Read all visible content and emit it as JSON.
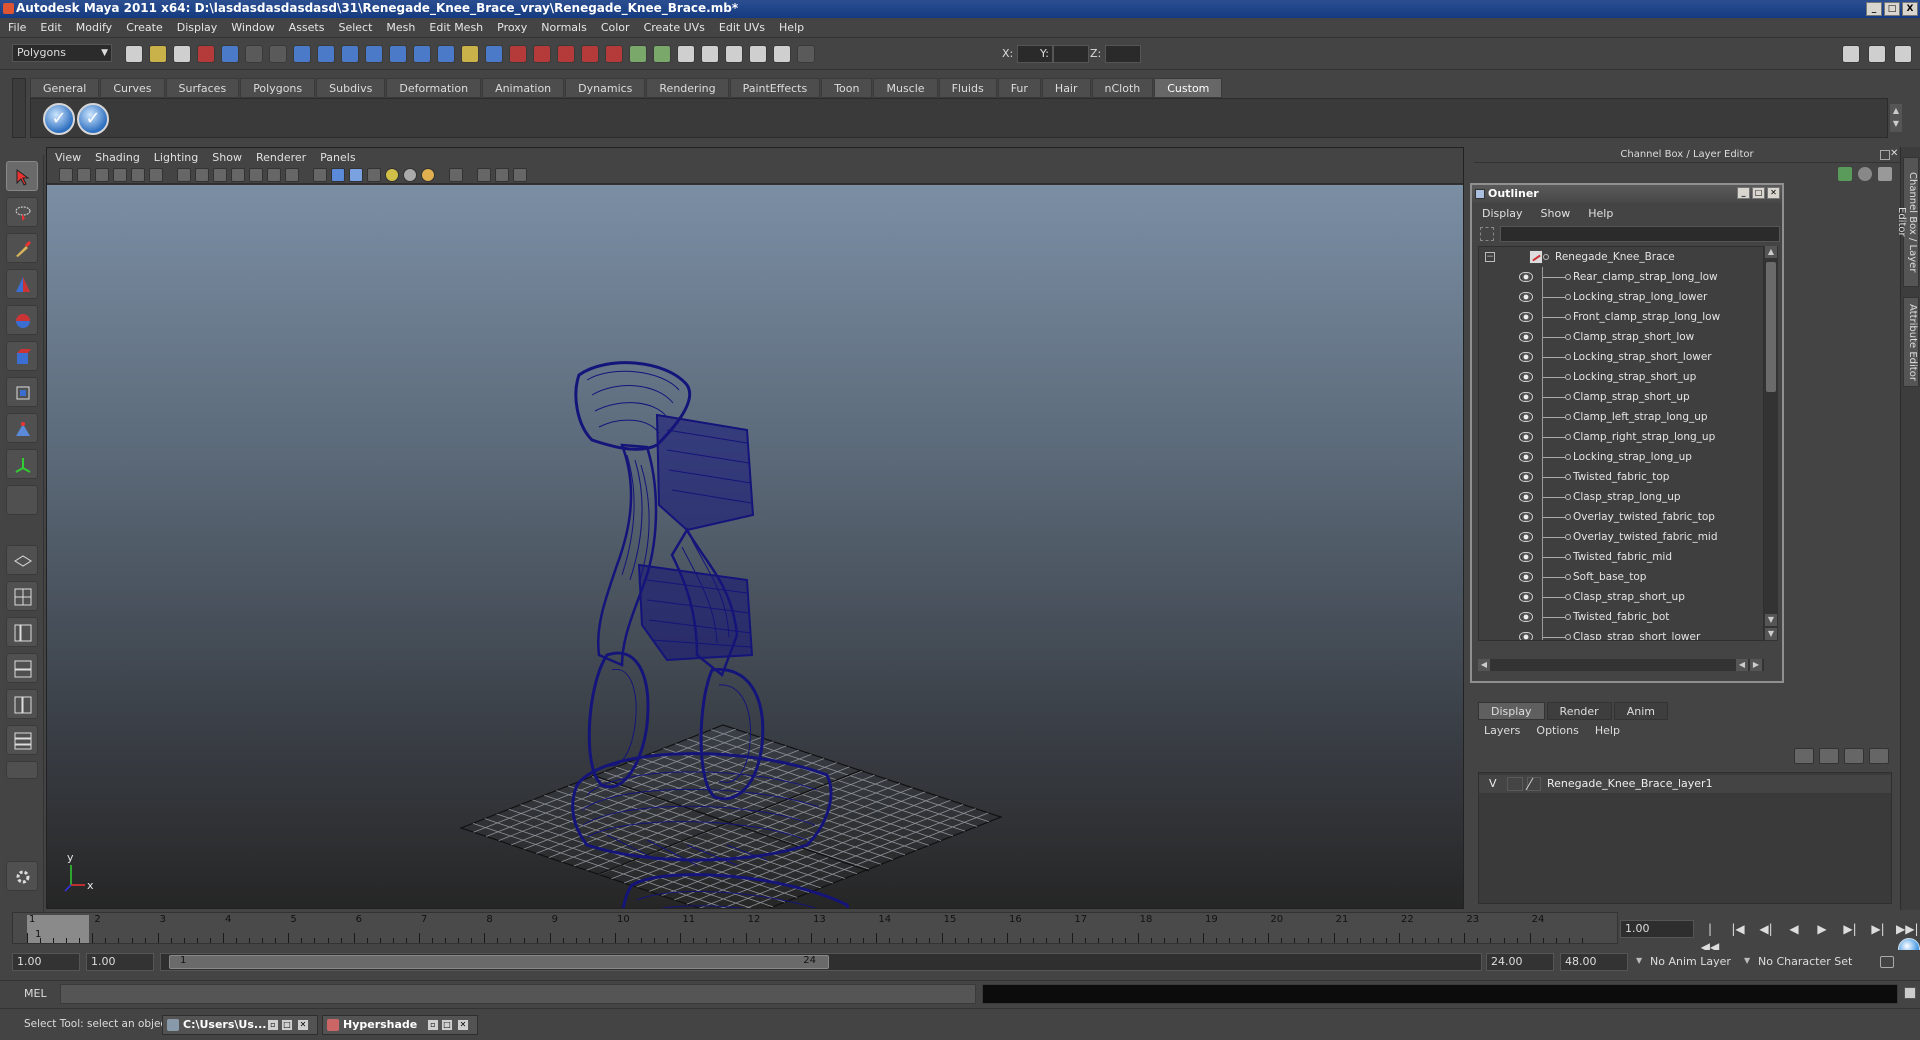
{
  "window": {
    "title": "Autodesk Maya 2011 x64: D:\\lasdasdasdasdasd\\31\\Renegade_Knee_Brace_vray\\Renegade_Knee_Brace.mb*",
    "min": "_",
    "max": "□",
    "close": "X"
  },
  "menubar": [
    "File",
    "Edit",
    "Modify",
    "Create",
    "Display",
    "Window",
    "Assets",
    "Select",
    "Mesh",
    "Edit Mesh",
    "Proxy",
    "Normals",
    "Color",
    "Create UVs",
    "Edit UVs",
    "Help"
  ],
  "statusline": {
    "mode": "Polygons",
    "x_label": "X:",
    "y_label": "Y:",
    "z_label": "Z:"
  },
  "shelf": {
    "tabs": [
      "General",
      "Curves",
      "Surfaces",
      "Polygons",
      "Subdivs",
      "Deformation",
      "Animation",
      "Dynamics",
      "Rendering",
      "PaintEffects",
      "Toon",
      "Muscle",
      "Fluids",
      "Fur",
      "Hair",
      "nCloth",
      "Custom"
    ],
    "active_tab": "Custom"
  },
  "viewport": {
    "menu": [
      "View",
      "Shading",
      "Lighting",
      "Show",
      "Renderer",
      "Panels"
    ],
    "axis_x": "x",
    "axis_y": "y",
    "wire_color": "#14147a"
  },
  "channel_box": {
    "header": "Channel Box / Layer Editor",
    "side_tabs": [
      "Channel Box / Layer Editor",
      "Attribute Editor"
    ]
  },
  "outliner": {
    "title": "Outliner",
    "menu": [
      "Display",
      "Show",
      "Help"
    ],
    "root": "Renegade_Knee_Brace",
    "items": [
      "Rear_clamp_strap_long_low",
      "Locking_strap_long_lower",
      "Front_clamp_strap_long_low",
      "Clamp_strap_short_low",
      "Locking_strap_short_lower",
      "Locking_strap_short_up",
      "Clamp_strap_short_up",
      "Clamp_left_strap_long_up",
      "Clamp_right_strap_long_up",
      "Locking_strap_long_up",
      "Twisted_fabric_top",
      "Clasp_strap_long_up",
      "Overlay_twisted_fabric_top",
      "Overlay_twisted_fabric_mid",
      "Twisted_fabric_mid",
      "Soft_base_top",
      "Clasp_strap_short_up",
      "Twisted_fabric_bot",
      "Clasp_strap_short_lower"
    ]
  },
  "layer_editor": {
    "tabs": [
      "Display",
      "Render",
      "Anim"
    ],
    "active_tab": "Display",
    "menu": [
      "Layers",
      "Options",
      "Help"
    ],
    "layer_visible": "V",
    "layer_name": "Renegade_Knee_Brace_layer1"
  },
  "timeline": {
    "ticks": [
      "1",
      "2",
      "3",
      "4",
      "5",
      "6",
      "7",
      "8",
      "9",
      "10",
      "11",
      "12",
      "13",
      "14",
      "15",
      "16",
      "17",
      "18",
      "19",
      "20",
      "21",
      "22",
      "23",
      "24"
    ],
    "current_frame_label": "1",
    "current_frame": "1.00",
    "playback": [
      "|◀◀",
      "|◀",
      "◀|",
      "◀",
      "▶",
      "▶|",
      "▶|",
      "▶▶|"
    ]
  },
  "range": {
    "start": "1.00",
    "anim_start": "1.00",
    "range_start": "1",
    "range_end": "24",
    "anim_end": "24.00",
    "end": "48.00",
    "anim_layer": "No Anim Layer",
    "char_set": "No Character Set"
  },
  "command": {
    "label": "MEL"
  },
  "helpline": {
    "text": "Select Tool: select an object",
    "tasks": [
      "C:\\Users\\Us...",
      "Hypershade"
    ]
  }
}
